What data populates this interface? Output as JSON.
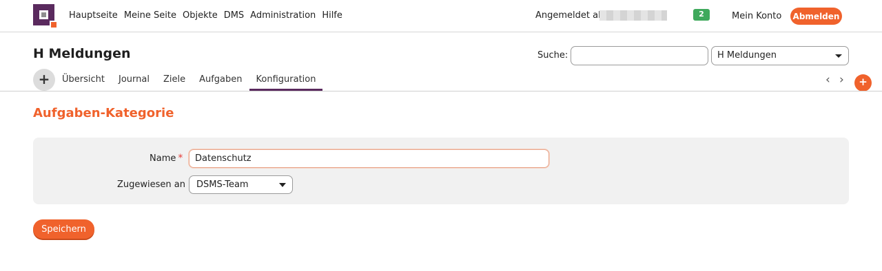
{
  "topnav": {
    "items": [
      "Hauptseite",
      "Meine Seite",
      "Objekte",
      "DMS",
      "Administration",
      "Hilfe"
    ],
    "login_label": "Angemeldet als",
    "notification_count": "2",
    "account_label": "Mein Konto",
    "logout_label": "Abmelden"
  },
  "header": {
    "title": "H Meldungen",
    "search_label": "Suche:",
    "search_value": "",
    "scope_selected": "H Meldungen"
  },
  "tabs": {
    "items": [
      "Übersicht",
      "Journal",
      "Ziele",
      "Aufgaben",
      "Konfiguration"
    ],
    "active": "Konfiguration",
    "add_symbol": "+",
    "new_symbol": "+",
    "prev_symbol": "‹",
    "next_symbol": "›"
  },
  "section": {
    "title": "Aufgaben-Kategorie"
  },
  "form": {
    "name_label": "Name",
    "required_mark": "*",
    "name_value": "Datenschutz",
    "assign_label": "Zugewiesen an",
    "assign_selected": "DSMS-Team",
    "save_label": "Speichern"
  },
  "colors": {
    "brand_purple": "#5a2a5e",
    "accent_orange": "#f0622c",
    "badge_green": "#3fa95c"
  }
}
